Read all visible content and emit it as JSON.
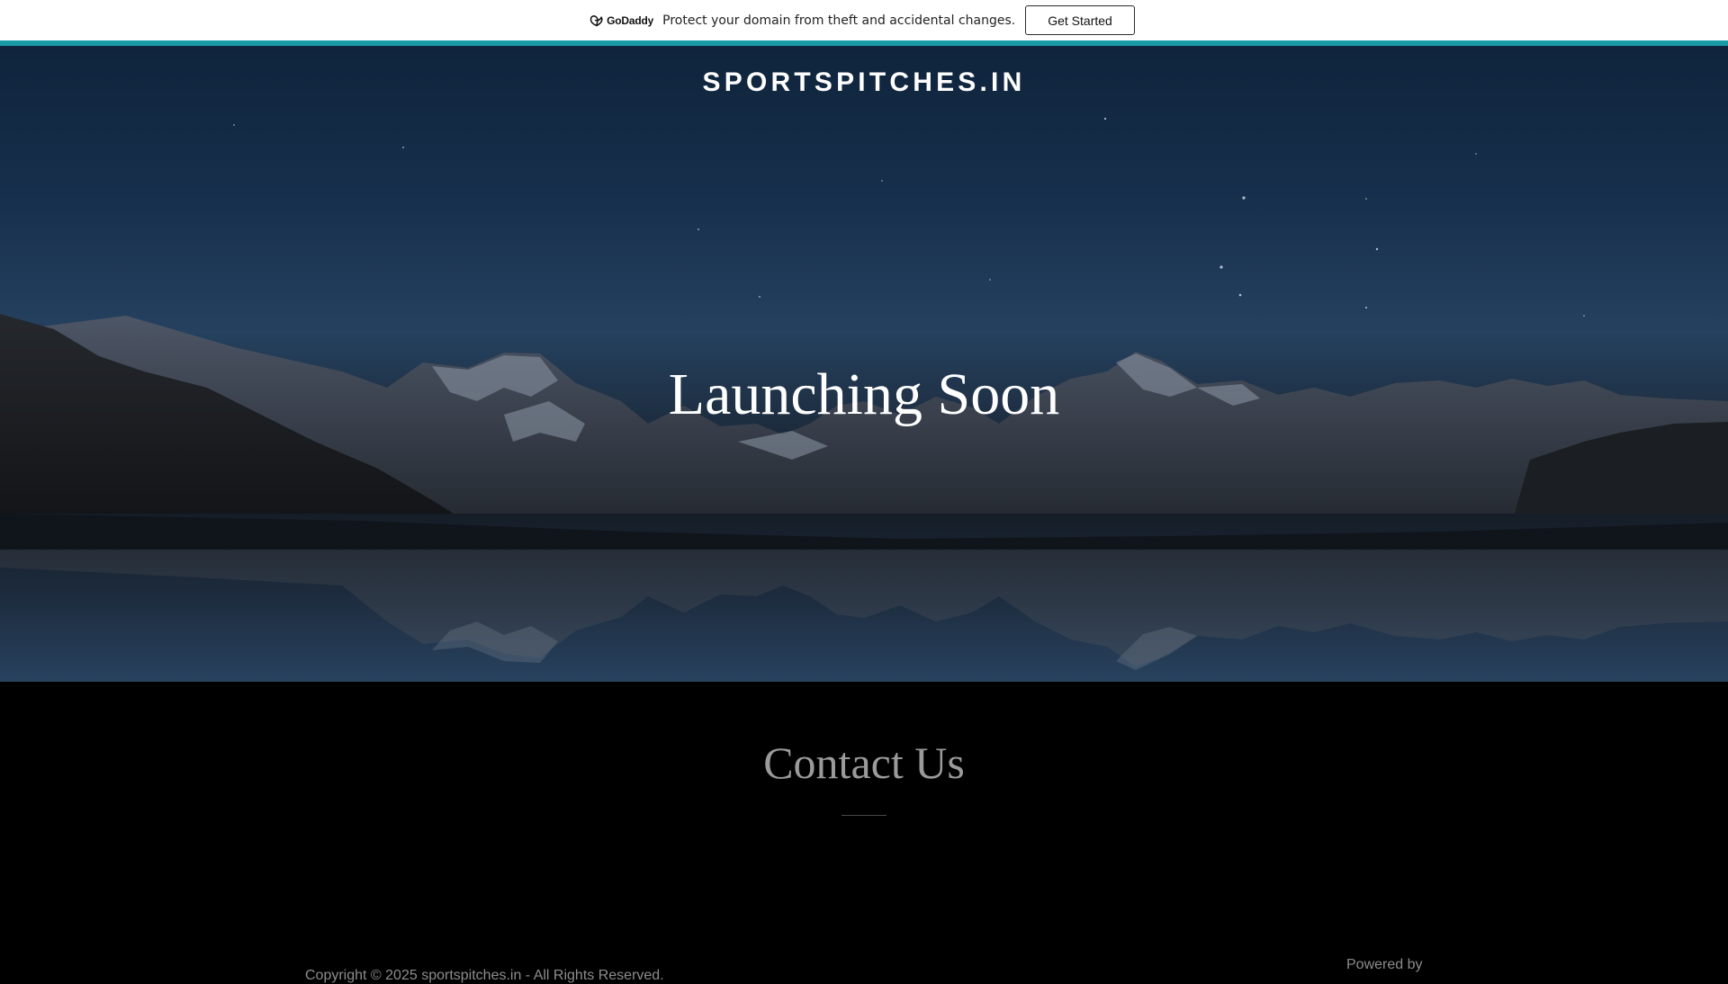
{
  "promo_bar": {
    "logo_text": "GoDaddy",
    "message": "Protect your domain from theft and accidental changes.",
    "cta_label": "Get Started",
    "accent_color": "#1a9ba8"
  },
  "hero": {
    "site_title": "SPORTSPITCHES.IN",
    "heading": "Launching Soon",
    "background": "night mountain lake with stars"
  },
  "contact": {
    "heading": "Contact Us"
  },
  "footer": {
    "copyright": "Copyright © 2025 sportspitches.in - All Rights Reserved.",
    "powered_by": "Powered by"
  }
}
